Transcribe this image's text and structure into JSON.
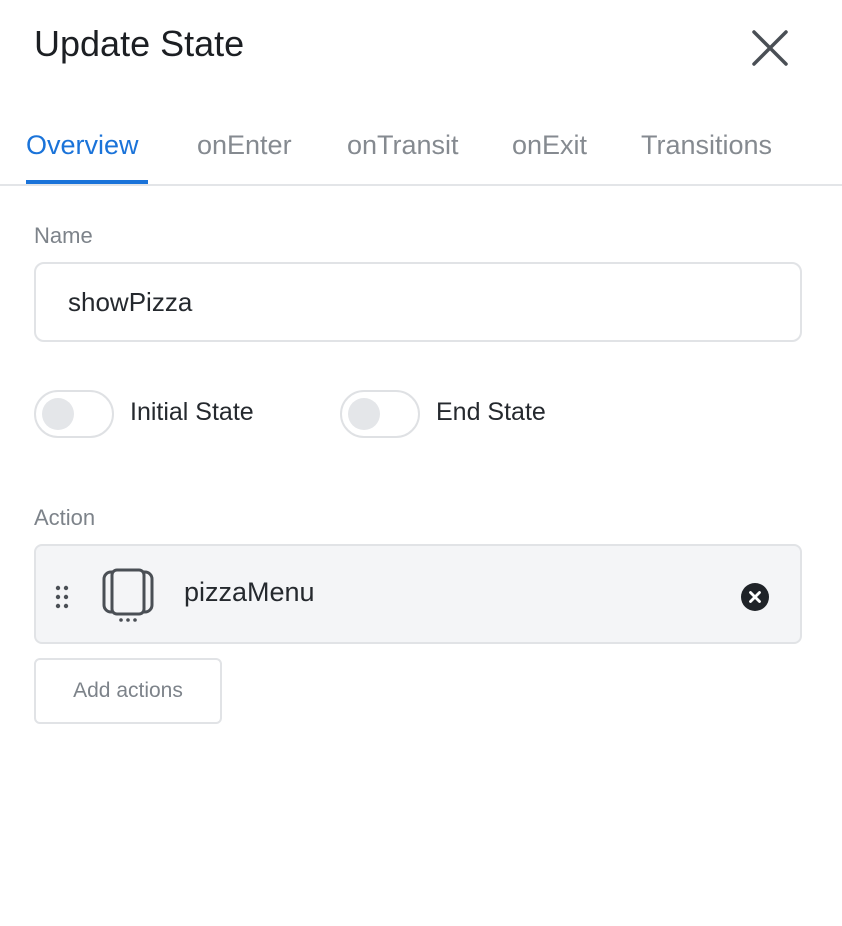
{
  "dialog": {
    "title": "Update State",
    "close_icon": "close-icon"
  },
  "tabs": [
    {
      "label": "Overview",
      "active": true
    },
    {
      "label": "onEnter",
      "active": false
    },
    {
      "label": "onTransit",
      "active": false
    },
    {
      "label": "onExit",
      "active": false
    },
    {
      "label": "Transitions",
      "active": false
    }
  ],
  "form": {
    "name_label": "Name",
    "name_value": "showPizza",
    "initial_state": {
      "label": "Initial State",
      "checked": false
    },
    "end_state": {
      "label": "End State",
      "checked": false
    },
    "action_label": "Action",
    "actions": [
      {
        "name": "pizzaMenu",
        "icon": "carousel-icon"
      }
    ],
    "add_actions_label": "Add actions"
  },
  "colors": {
    "accent": "#1a73d9",
    "muted_text": "#858a90",
    "border": "#e1e3e6",
    "card_bg": "#f4f5f7"
  }
}
